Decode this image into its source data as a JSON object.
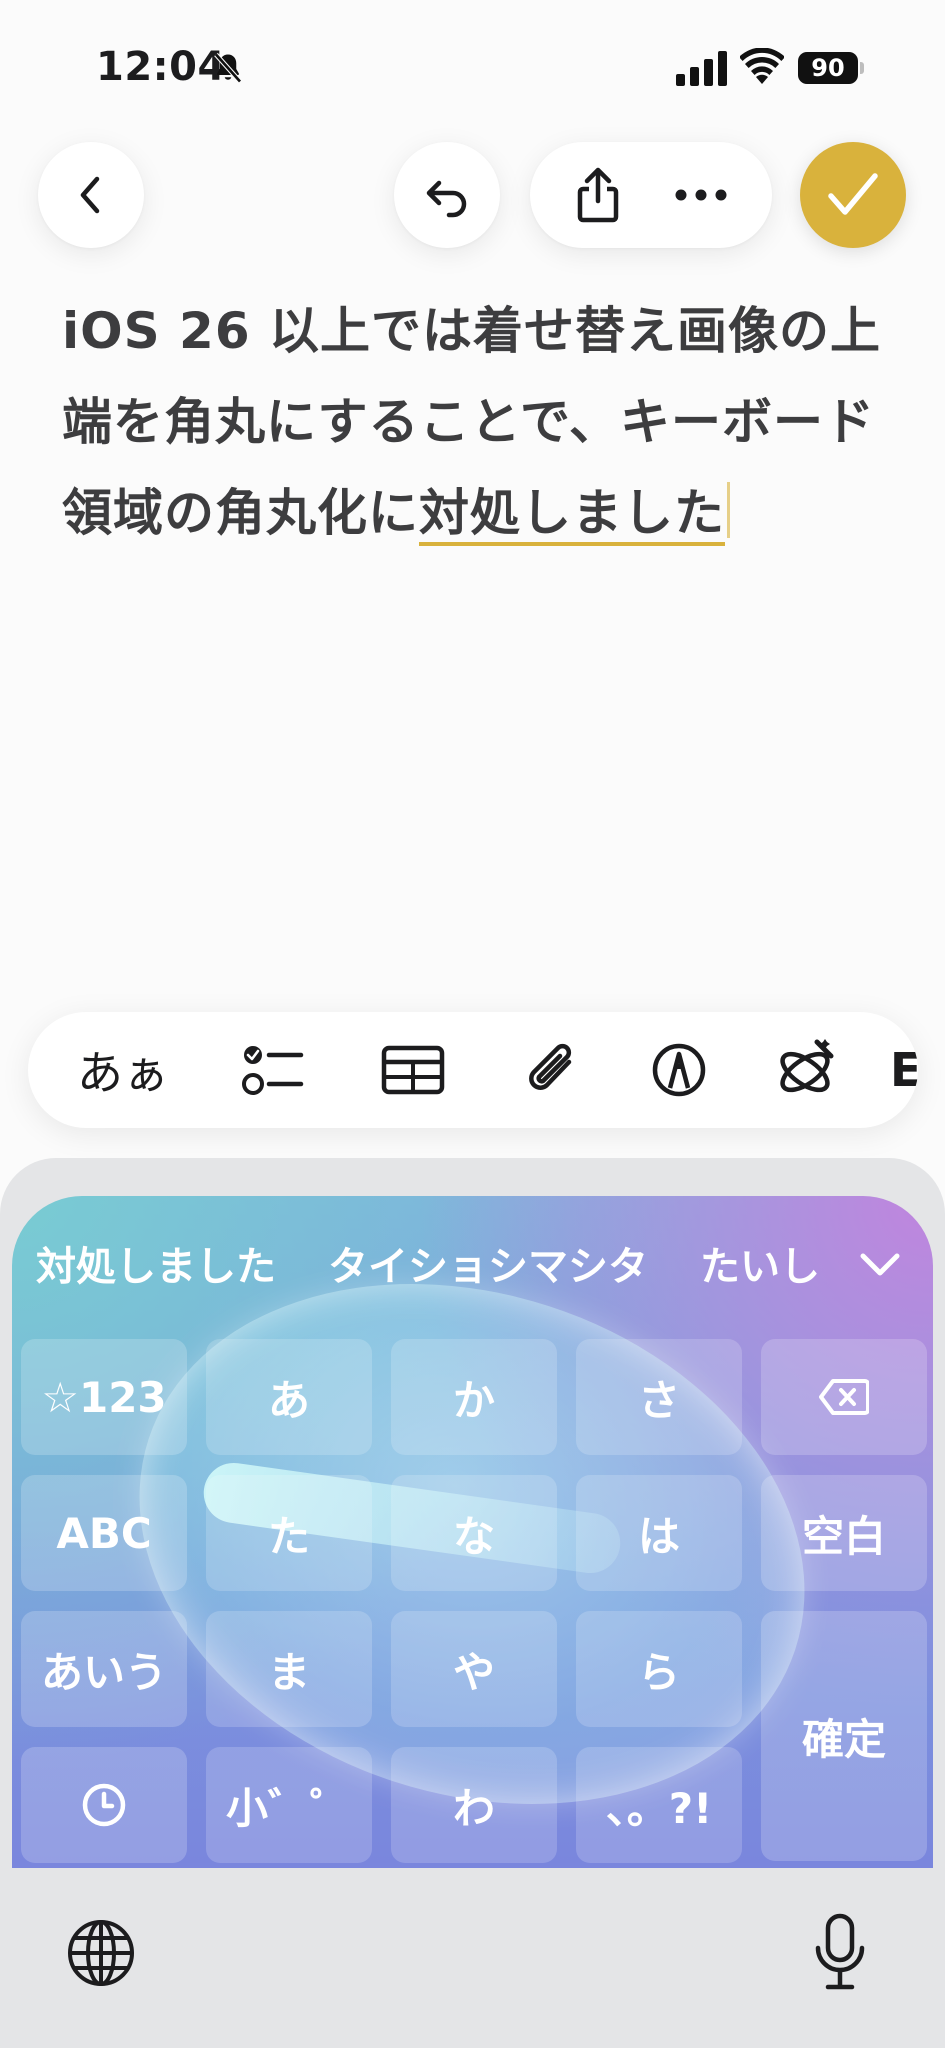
{
  "status_bar": {
    "time": "12:04",
    "battery": "90"
  },
  "note": {
    "text_plain": "iOS 26 以上では着せ替え画像の上端を角丸にすることで、キーボード領域の角丸化に",
    "text_marked": "対処しました"
  },
  "format_bar": {
    "text_style_label": "あぁ"
  },
  "keyboard": {
    "candidates": [
      "対処しました",
      "タイショシマシタ",
      "たいし"
    ],
    "keys": {
      "symbols": "☆123",
      "a": "あ",
      "ka": "か",
      "sa": "さ",
      "abc": "ABC",
      "ta": "た",
      "na": "な",
      "ha": "は",
      "space": "空白",
      "aiu": "あいう",
      "ma": "ま",
      "ya": "や",
      "ra": "ら",
      "confirm": "確定",
      "small": "小゛゜",
      "wa": "わ",
      "punct": "、。?!"
    }
  },
  "colors": {
    "accent": "#d9b23c",
    "keyboard_shell": "#e4e5e7"
  }
}
